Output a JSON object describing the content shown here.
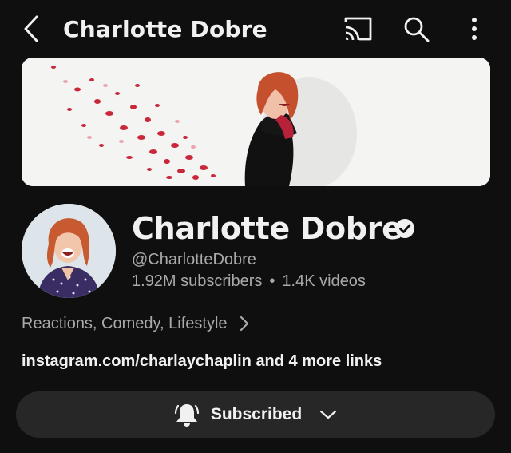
{
  "header": {
    "title": "Charlotte Dobre",
    "back_icon": "chevron-left-icon",
    "cast_icon": "cast-icon",
    "search_icon": "search-icon",
    "more_icon": "more-vertical-icon"
  },
  "channel": {
    "name": "Charlotte Dobre",
    "verified": true,
    "handle": "@CharlotteDobre",
    "subscribers": "1.92M subscribers",
    "separator": "•",
    "videos": "1.4K videos",
    "categories": "Reactions, Comedy, Lifestyle",
    "links": "instagram.com/charlaychaplin and 4 more links"
  },
  "subscribe": {
    "label": "Subscribed",
    "bell_icon": "bell-icon",
    "dropdown_icon": "chevron-down-icon"
  },
  "colors": {
    "background": "#0f0f0f",
    "button": "#272727",
    "text_primary": "#f1f1f1",
    "text_secondary": "#aaaaaa"
  }
}
